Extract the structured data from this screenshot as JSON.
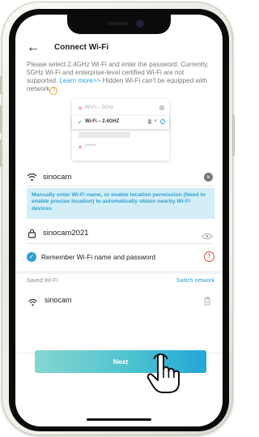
{
  "header": {
    "back_icon": "arrow-left-icon",
    "title": "Connect Wi-Fi"
  },
  "intro": {
    "text": "Please select 2.4GHz Wi-Fi and enter the password. Currently, 5GHz Wi-Fi and enterprise-level certified Wi-Fi are not supported.",
    "link": "Learn more>>",
    "text2": "Hidden Wi-Fi can't be equipped with network",
    "help_icon": "question-icon",
    "help_glyph": "?"
  },
  "illustration": {
    "rows": [
      {
        "mark": "✕",
        "label": "Wi-Fi – 5Ghz"
      },
      {
        "mark": "✓",
        "label": "Wi-Fi – 2.4GHZ"
      },
      {
        "mark": "✕",
        "label": "******"
      }
    ]
  },
  "wifi_field": {
    "value": "sinocam",
    "clear_glyph": "×"
  },
  "notice": "Manually enter Wi-Fi name, or enable location permission (Need to enable precise location) to automatically obtain nearby Wi-Fi devices",
  "password_field": {
    "value": "sinocam2021"
  },
  "remember": {
    "label": "Remember Wi-Fi name and password",
    "check_glyph": "✓",
    "warn_glyph": "!"
  },
  "saved": {
    "label": "Saved Wi-Fi",
    "switch_label": "Switch network",
    "items": [
      {
        "name": "sinocam"
      }
    ]
  },
  "next_button": {
    "label": "Next"
  },
  "colors": {
    "accent": "#2e9fd6",
    "warning": "#e04b3c",
    "link": "#2f9fe0",
    "notice_bg": "#d3eef7"
  }
}
